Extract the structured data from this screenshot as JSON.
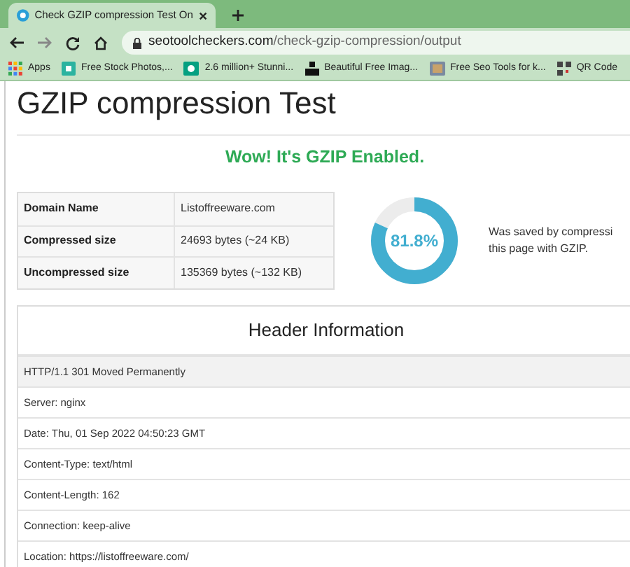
{
  "browser": {
    "tab": {
      "title": "Check GZIP compression Test On"
    },
    "address": {
      "domain": "seotoolcheckers.com",
      "path": "/check-gzip-compression/output"
    },
    "bookmarks": [
      {
        "label": "Apps",
        "kind": "apps"
      },
      {
        "label": "Free Stock Photos,...",
        "kind": "teal"
      },
      {
        "label": "2.6 million+ Stunni...",
        "kind": "green"
      },
      {
        "label": "Beautiful Free Imag...",
        "kind": "black"
      },
      {
        "label": "Free Seo Tools for k...",
        "kind": "gray"
      },
      {
        "label": "QR Code",
        "kind": "qr"
      }
    ]
  },
  "page": {
    "title": "GZIP compression Test",
    "status": "Wow! It's GZIP Enabled.",
    "table": [
      {
        "label": "Domain Name",
        "value": "Listoffreeware.com"
      },
      {
        "label": "Compressed size",
        "value": "24693 bytes (~24 KB)"
      },
      {
        "label": "Uncompressed size",
        "value": "135369 bytes (~132 KB)"
      }
    ],
    "donut": {
      "level": 0.818,
      "reading": "81.8%"
    },
    "saved_text": [
      "Was saved by compressi",
      "this page with GZIP."
    ],
    "header_info": {
      "title": "Header Information",
      "rows": [
        {
          "text": "HTTP/1.1 301 Moved Permanently",
          "selected": true
        },
        {
          "text": "Server: nginx",
          "selected": false
        },
        {
          "text": "Date: Thu, 01 Sep 2022 04:50:23 GMT",
          "selected": false
        },
        {
          "text": "Content-Type: text/html",
          "selected": false
        },
        {
          "text": "Content-Length: 162",
          "selected": false
        },
        {
          "text": "Connection: keep-alive",
          "selected": false
        },
        {
          "text": "Location: https://listoffreeware.com/",
          "selected": false
        }
      ]
    }
  }
}
